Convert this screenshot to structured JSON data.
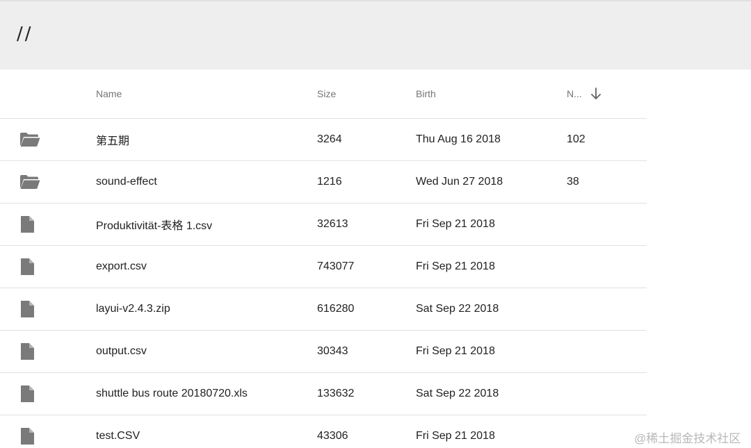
{
  "path": "//",
  "columns": {
    "name": "Name",
    "size": "Size",
    "birth": "Birth",
    "n": "N..."
  },
  "rows": [
    {
      "type": "folder",
      "icon": "folder-open-icon",
      "name": "第五期",
      "size": "3264",
      "birth": "Thu Aug 16 2018",
      "n": "102"
    },
    {
      "type": "folder",
      "icon": "folder-open-icon",
      "name": "sound-effect",
      "size": "1216",
      "birth": "Wed Jun 27 2018",
      "n": "38"
    },
    {
      "type": "file",
      "icon": "file-icon",
      "name": "Produktivität-表格 1.csv",
      "size": "32613",
      "birth": "Fri Sep 21 2018",
      "n": ""
    },
    {
      "type": "file",
      "icon": "file-icon",
      "name": "export.csv",
      "size": "743077",
      "birth": "Fri Sep 21 2018",
      "n": ""
    },
    {
      "type": "file",
      "icon": "file-icon",
      "name": "layui-v2.4.3.zip",
      "size": "616280",
      "birth": "Sat Sep 22 2018",
      "n": ""
    },
    {
      "type": "file",
      "icon": "file-icon",
      "name": "output.csv",
      "size": "30343",
      "birth": "Fri Sep 21 2018",
      "n": ""
    },
    {
      "type": "file",
      "icon": "file-icon",
      "name": "shuttle bus route 20180720.xls",
      "size": "133632",
      "birth": "Sat Sep 22 2018",
      "n": ""
    },
    {
      "type": "file",
      "icon": "file-icon",
      "name": "test.CSV",
      "size": "43306",
      "birth": "Fri Sep 21 2018",
      "n": ""
    }
  ],
  "watermark": "@稀土掘金技术社区"
}
